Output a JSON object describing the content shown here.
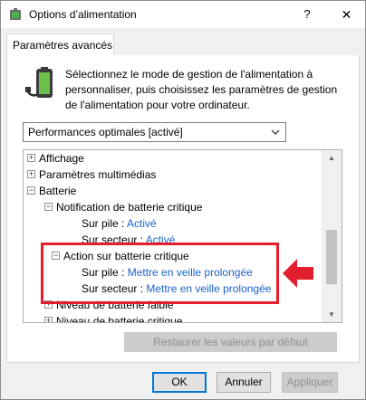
{
  "window": {
    "title": "Options d’alimentation",
    "help_glyph": "?",
    "close_glyph": "✕"
  },
  "tab": {
    "label": "Paramètres avancés"
  },
  "description": "Sélectionnez le mode de gestion de l'alimentation à personnaliser, puis choisissez les paramètres de gestion de l'alimentation pour votre ordinateur.",
  "plan_select": {
    "value": "Performances optimales [activé]"
  },
  "tree": {
    "items": [
      {
        "label": "Affichage",
        "expander": "+"
      },
      {
        "label": "Paramètres multimédias",
        "expander": "+"
      },
      {
        "label": "Batterie",
        "expander": "−"
      },
      {
        "label": "Notification de batterie critique",
        "expander": "−"
      },
      {
        "label": "Sur pile :",
        "value": "Activé"
      },
      {
        "label": "Sur secteur :",
        "value": "Activé"
      },
      {
        "label": "Action sur batterie critique",
        "expander": "−"
      },
      {
        "label": "Sur pile :",
        "value": "Mettre en veille prolongée"
      },
      {
        "label": "Sur secteur :",
        "value": "Mettre en veille prolongée"
      },
      {
        "label": "Niveau de batterie faible",
        "expander": "+"
      },
      {
        "label": "Niveau de batterie critique",
        "expander": "+"
      }
    ]
  },
  "buttons": {
    "restore": "Restaurer les valeurs par défaut",
    "ok": "OK",
    "cancel": "Annuler",
    "apply": "Appliquer"
  },
  "colors": {
    "highlight": "#e31e2d",
    "link_value": "#1a62c9",
    "default_button_border": "#0078d7"
  },
  "icons": {
    "app": "battery-icon",
    "dropdown": "chevron-down-icon",
    "annotation": "red-arrow-icon"
  }
}
